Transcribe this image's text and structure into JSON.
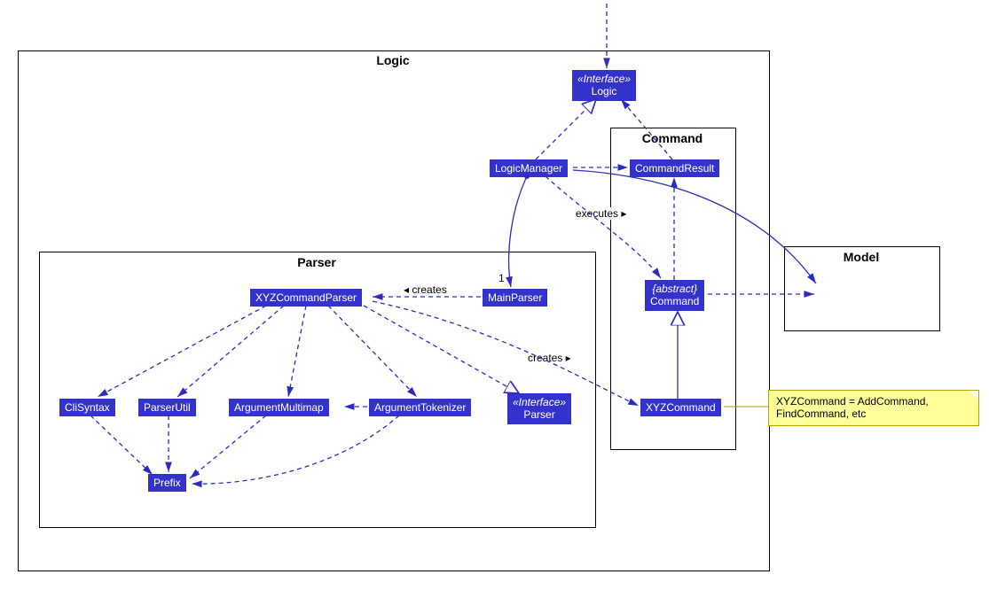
{
  "packages": {
    "logic": "Logic",
    "parser": "Parser",
    "command": "Command",
    "model": "Model"
  },
  "nodes": {
    "logicIf": {
      "stereotype": "«Interface»",
      "name": "Logic"
    },
    "logicManager": "LogicManager",
    "commandResult": "CommandResult",
    "abstractCommand": {
      "stereotype": "{abstract}",
      "name": "Command"
    },
    "xyzCommand": "XYZCommand",
    "mainParser": "MainParser",
    "xyzCommandParser": "XYZCommandParser",
    "cliSyntax": "CliSyntax",
    "parserUtil": "ParserUtil",
    "argMultimap": "ArgumentMultimap",
    "argTokenizer": "ArgumentTokenizer",
    "parserIf": {
      "stereotype": "«Interface»",
      "name": "Parser"
    },
    "prefix": "Prefix"
  },
  "labels": {
    "createsMainParser": "◂ creates",
    "executes": "executes ▸",
    "createsCommand": "creates ▸",
    "one": "1"
  },
  "note": "XYZCommand = AddCommand,\nFindCommand, etc"
}
